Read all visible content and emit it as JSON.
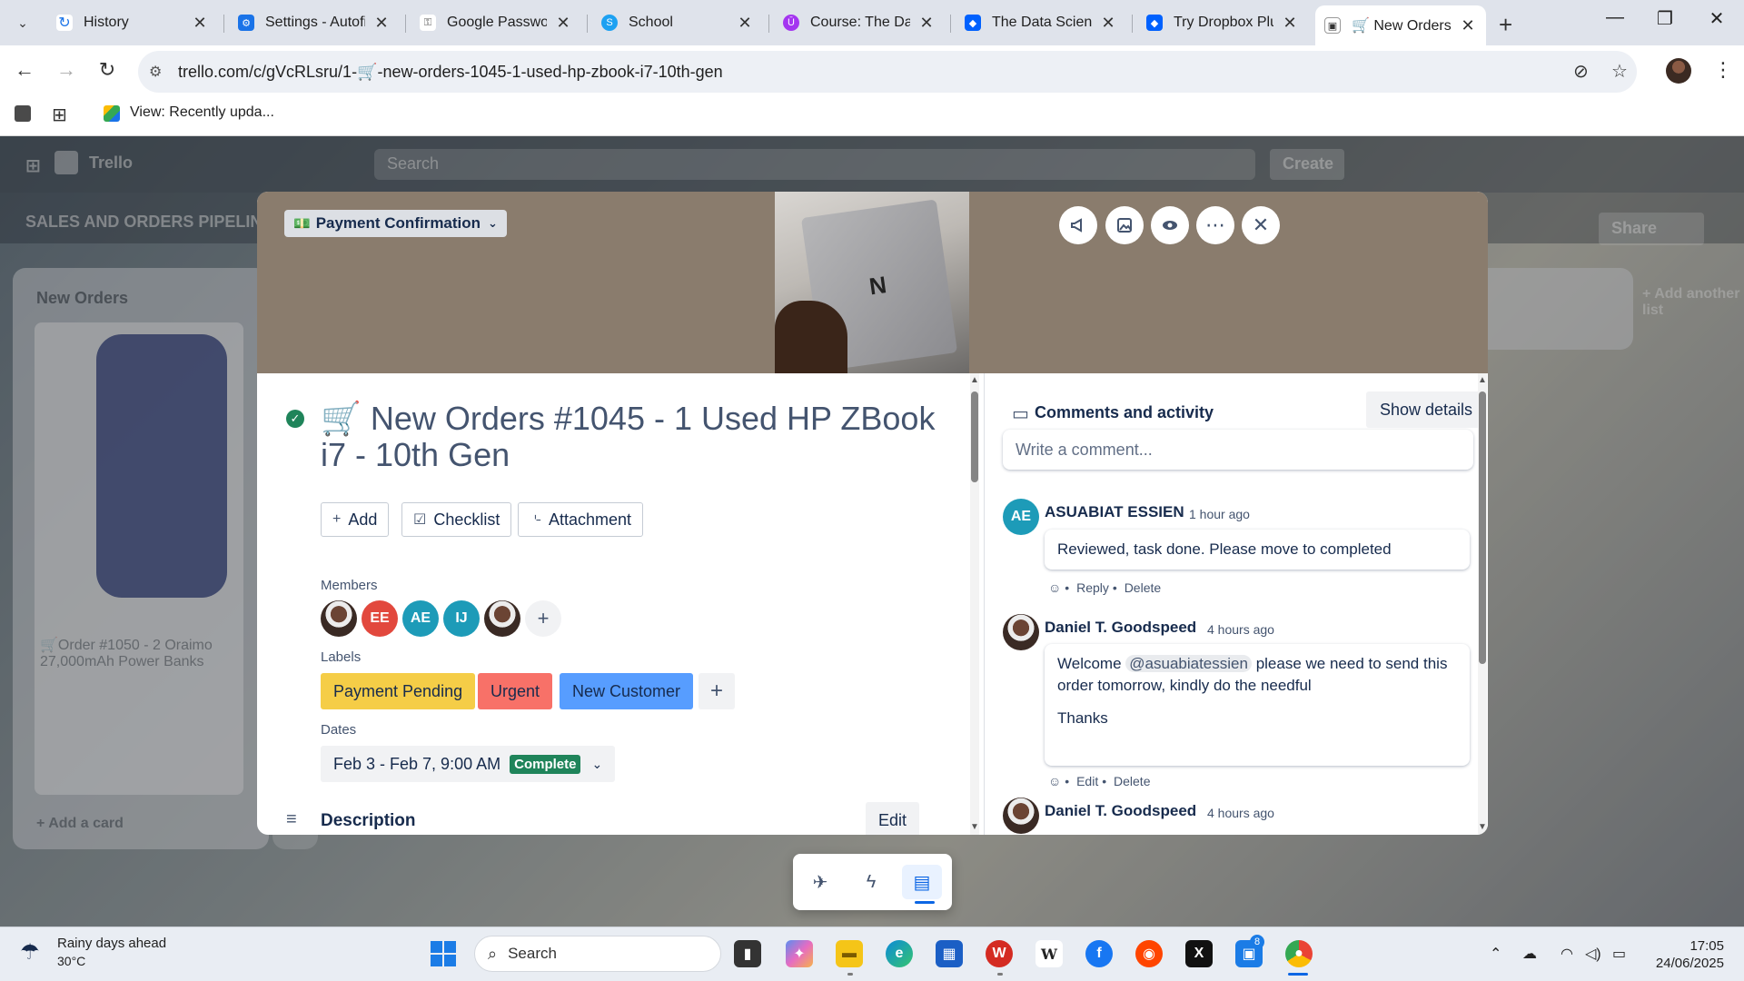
{
  "browser": {
    "tabs": [
      {
        "title": "History",
        "icon": "history-icon"
      },
      {
        "title": "Settings - Autofill",
        "icon": "gear-icon"
      },
      {
        "title": "Google Password",
        "icon": "key-icon"
      },
      {
        "title": "School",
        "icon": "skype-icon"
      },
      {
        "title": "Course: The Data",
        "icon": "course-icon"
      },
      {
        "title": "The Data Science",
        "icon": "dropbox-icon"
      },
      {
        "title": "Try Dropbox Plus",
        "icon": "dropbox-icon"
      },
      {
        "title": "🛒 New Orders",
        "icon": "trello-icon"
      }
    ],
    "url": "trello.com/c/gVcRLsru/1-🛒-new-orders-1045-1-used-hp-zbook-i7-10th-gen",
    "bookmark": "View: Recently upda..."
  },
  "background": {
    "app_name": "Trello",
    "search": "Search",
    "create": "Create",
    "board_title": "SALES AND ORDERS PIPELINE",
    "list_title": "New Orders",
    "card_text": "🛒Order #1050 - 2 Oraimo 27,000mAh Power Banks",
    "share": "Share",
    "add_card": "+ Add a card",
    "add_another": "+ Add another list"
  },
  "card": {
    "list_name": "Payment Confirmation",
    "title": "🛒 New Orders #1045 - 1 Used HP ZBook i7 - 10th Gen",
    "actions": {
      "add": "Add",
      "checklist": "Checklist",
      "attachment": "Attachment"
    },
    "members_label": "Members",
    "members": [
      {
        "initials": "",
        "photo": true
      },
      {
        "initials": "EE",
        "color": "#e2483d"
      },
      {
        "initials": "AE",
        "color": "#1d9bb8"
      },
      {
        "initials": "IJ",
        "color": "#1d9bb8"
      },
      {
        "initials": "",
        "photo": true
      }
    ],
    "labels_label": "Labels",
    "labels": [
      {
        "text": "Payment Pending",
        "bg": "#f5cd47",
        "fg": "#172b4d"
      },
      {
        "text": "Urgent",
        "bg": "#f87168",
        "fg": "#172b4d"
      },
      {
        "text": "New Customer",
        "bg": "#579dff",
        "fg": "#172b4d"
      }
    ],
    "dates_label": "Dates",
    "dates_value": "Feb 3 - Feb 7, 9:00 AM",
    "dates_status": "Complete",
    "description_label": "Description",
    "edit_label": "Edit"
  },
  "activity": {
    "title": "Comments and activity",
    "show_details": "Show details",
    "comment_placeholder": "Write a comment...",
    "comments": [
      {
        "initials": "AE",
        "author": "ASUABIAT ESSIEN",
        "time": "1 hour ago",
        "body": "Reviewed, task done. Please move to completed",
        "actions": [
          "Reply",
          "Delete"
        ]
      },
      {
        "initials": "",
        "author": "Daniel T. Goodspeed",
        "time": "4 hours ago",
        "body_pre": "Welcome",
        "mention": "@asuabiatessien",
        "body_post": "please we need to send this order tomorrow, kindly do the needful",
        "body_extra": "Thanks",
        "actions": [
          "Edit",
          "Delete"
        ]
      },
      {
        "initials": "",
        "author": "Daniel T. Goodspeed",
        "time": "4 hours ago"
      }
    ]
  },
  "taskbar": {
    "weather_title": "Rainy days ahead",
    "weather_temp": "30°C",
    "search": "Search",
    "time": "17:05",
    "date": "24/06/2025",
    "notification_count": "8"
  }
}
